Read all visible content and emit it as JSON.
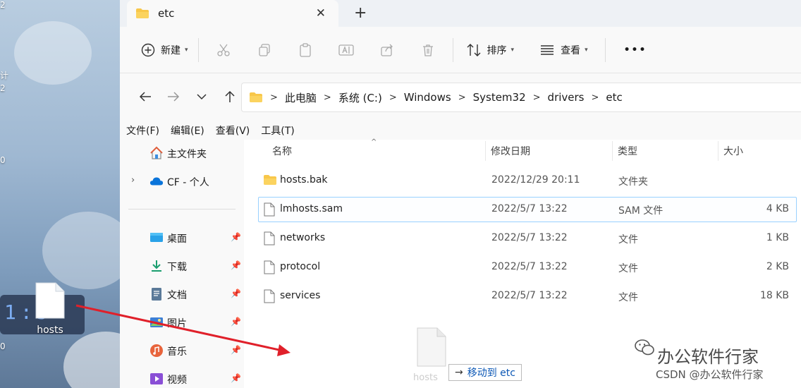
{
  "desktop": {
    "file_label": "hosts",
    "edge_texts": [
      "2",
      "计",
      "2",
      "0",
      "0"
    ],
    "clock": "1:5"
  },
  "tab": {
    "title": "etc",
    "close": "✕",
    "add": "+"
  },
  "toolbar": {
    "new_label": "新建",
    "sort_label": "排序",
    "view_label": "查看",
    "more_label": "•••"
  },
  "address": {
    "crumbs": [
      "此电脑",
      "系统 (C:)",
      "Windows",
      "System32",
      "drivers",
      "etc"
    ]
  },
  "menu": [
    "文件(F)",
    "编辑(E)",
    "查看(V)",
    "工具(T)"
  ],
  "sidebar": {
    "home": "主文件夹",
    "onedrive": "CF - 个人",
    "quick": [
      {
        "label": "桌面",
        "icon": "desktop-icon"
      },
      {
        "label": "下载",
        "icon": "download-icon"
      },
      {
        "label": "文档",
        "icon": "document-icon"
      },
      {
        "label": "图片",
        "icon": "pictures-icon"
      },
      {
        "label": "音乐",
        "icon": "music-icon"
      },
      {
        "label": "视频",
        "icon": "video-icon"
      }
    ]
  },
  "columns": {
    "name": "名称",
    "date": "修改日期",
    "type": "类型",
    "size": "大小"
  },
  "files": [
    {
      "name": "hosts.bak",
      "date": "2022/12/29 20:11",
      "type": "文件夹",
      "size": "",
      "kind": "folder"
    },
    {
      "name": "lmhosts.sam",
      "date": "2022/5/7 13:22",
      "type": "SAM 文件",
      "size": "4 KB",
      "kind": "file"
    },
    {
      "name": "networks",
      "date": "2022/5/7 13:22",
      "type": "文件",
      "size": "1 KB",
      "kind": "file"
    },
    {
      "name": "protocol",
      "date": "2022/5/7 13:22",
      "type": "文件",
      "size": "2 KB",
      "kind": "file"
    },
    {
      "name": "services",
      "date": "2022/5/7 13:22",
      "type": "文件",
      "size": "18 KB",
      "kind": "file"
    }
  ],
  "drag": {
    "ghost_label": "hosts",
    "tip_arrow": "→",
    "tip_text": "移动到 etc"
  },
  "watermark": {
    "main": "办公软件行家",
    "sub": "CSDN @办公软件行家"
  },
  "colors": {
    "accent": "#0067c0",
    "arrow": "#e0202a",
    "folder": "#f8c74a",
    "selection": "#99d1ff"
  }
}
